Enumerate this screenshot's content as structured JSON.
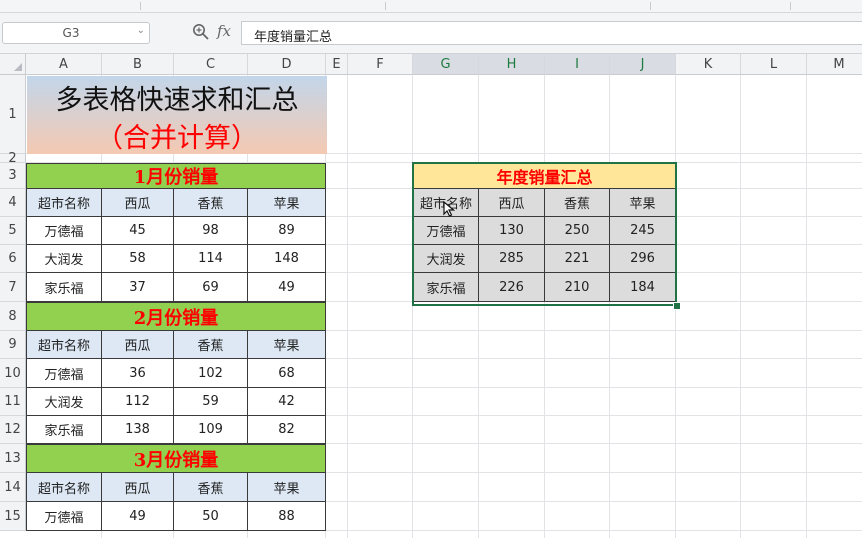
{
  "formula_bar": {
    "name_box": "G3",
    "fx_label": "fx",
    "zoom_icon": "magnifier-icon",
    "formula": "年度销量汇总"
  },
  "columns": [
    "A",
    "B",
    "C",
    "D",
    "E",
    "F",
    "G",
    "H",
    "I",
    "J",
    "K",
    "L",
    "M"
  ],
  "selected_columns": [
    "G",
    "H",
    "I",
    "J"
  ],
  "rows": [
    "1",
    "2",
    "3",
    "4",
    "5",
    "6",
    "7",
    "8",
    "9",
    "10",
    "11",
    "12",
    "13",
    "14",
    "15"
  ],
  "title": {
    "line1": "多表格快速求和汇总",
    "line2": "（合并计算）"
  },
  "headers": [
    "超市名称",
    "西瓜",
    "香蕉",
    "苹果"
  ],
  "months": [
    {
      "label": "1月份销量",
      "rows": [
        [
          "万德福",
          "45",
          "98",
          "89"
        ],
        [
          "大润发",
          "58",
          "114",
          "148"
        ],
        [
          "家乐福",
          "37",
          "69",
          "49"
        ]
      ]
    },
    {
      "label": "2月份销量",
      "rows": [
        [
          "万德福",
          "36",
          "102",
          "68"
        ],
        [
          "大润发",
          "112",
          "59",
          "42"
        ],
        [
          "家乐福",
          "138",
          "109",
          "82"
        ]
      ]
    },
    {
      "label": "3月份销量",
      "rows": [
        [
          "万德福",
          "49",
          "50",
          "88"
        ]
      ]
    }
  ],
  "summary": {
    "title": "年度销量汇总",
    "headers": [
      "超市名称",
      "西瓜",
      "香蕉",
      "苹果"
    ],
    "rows": [
      [
        "万德福",
        "130",
        "250",
        "245"
      ],
      [
        "大润发",
        "285",
        "221",
        "296"
      ],
      [
        "家乐福",
        "226",
        "210",
        "184"
      ]
    ]
  }
}
